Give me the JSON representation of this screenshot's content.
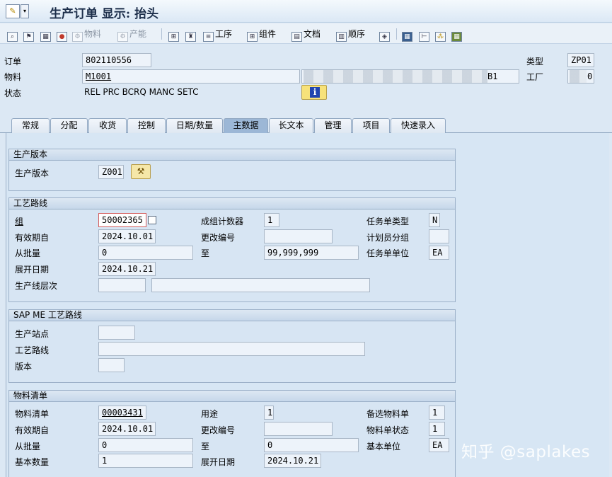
{
  "title": "生产订单 显示: 抬头",
  "toolbar": {
    "material_label": "物料",
    "capacity_label": "产能",
    "operations_label": "工序",
    "components_label": "组件",
    "documents_label": "文档",
    "sequence_label": "顺序"
  },
  "header": {
    "order_label": "订单",
    "order_value": "802110556",
    "material_label": "物料",
    "material_value": "M1001",
    "material_desc_suffix": "B1",
    "status_label": "状态",
    "status_value": "REL  PRC  BCRQ MANC SETC",
    "type_label": "类型",
    "type_value": "ZP01",
    "plant_label": "工厂",
    "plant_value_suffix": "0"
  },
  "tabs": [
    {
      "label": "常规"
    },
    {
      "label": "分配"
    },
    {
      "label": "收货"
    },
    {
      "label": "控制"
    },
    {
      "label": "日期/数量"
    },
    {
      "label": "主数据",
      "active": true
    },
    {
      "label": "长文本"
    },
    {
      "label": "管理"
    },
    {
      "label": "项目"
    },
    {
      "label": "快速录入"
    }
  ],
  "production_version": {
    "title": "生产版本",
    "label": "生产版本",
    "value": "Z001"
  },
  "routing": {
    "title": "工艺路线",
    "group_label": "组",
    "group_value": "50002365",
    "valid_from_label": "有效期自",
    "valid_from_value": "2024.10.01",
    "from_lot_label": "从批量",
    "from_lot_value": "0",
    "explosion_date_label": "展开日期",
    "explosion_date_value": "2024.10.21",
    "line_hierarchy_label": "生产线层次",
    "line_hierarchy_value": "",
    "line_hierarchy_desc": "",
    "group_counter_label": "成组计数器",
    "group_counter_value": "1",
    "change_no_label": "更改编号",
    "change_no_value": "",
    "to_label": "至",
    "to_value": "99,999,999",
    "task_type_label": "任务单类型",
    "task_type_value": "N",
    "planner_group_label": "计划员分组",
    "planner_group_value": "",
    "task_unit_label": "任务单单位",
    "task_unit_value": "EA"
  },
  "sapme": {
    "title": "SAP ME 工艺路线",
    "site_label": "生产站点",
    "site_value": "",
    "routing_label": "工艺路线",
    "routing_value": "",
    "version_label": "版本",
    "version_value": ""
  },
  "bom": {
    "title": "物料清单",
    "bom_label": "物料清单",
    "bom_value": "00003431",
    "valid_from_label": "有效期自",
    "valid_from_value": "2024.10.01",
    "from_lot_label": "从批量",
    "from_lot_value": "0",
    "base_qty_label": "基本数量",
    "base_qty_value": "1",
    "usage_label": "用途",
    "usage_value": "1",
    "change_no_label": "更改编号",
    "change_no_value": "",
    "to_label": "至",
    "to_value": "0",
    "explosion_date_label": "展开日期",
    "explosion_date_value": "2024.10.21",
    "alt_bom_label": "备选物料单",
    "alt_bom_value": "1",
    "bom_status_label": "物料单状态",
    "bom_status_value": "1",
    "base_unit_label": "基本单位",
    "base_unit_value": "EA"
  },
  "watermark": "知乎 @saplakes"
}
